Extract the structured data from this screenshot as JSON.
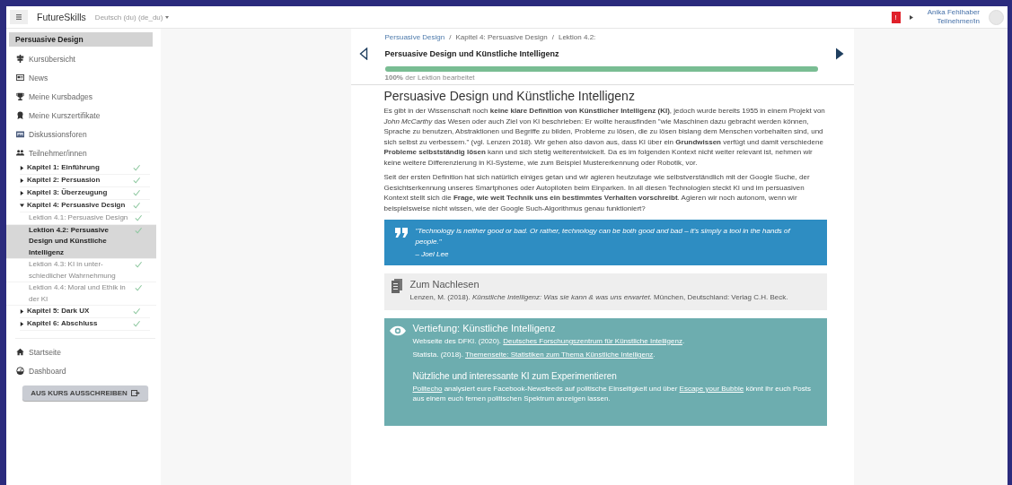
{
  "header": {
    "brand": "FutureSkills",
    "language": "Deutsch (du) (de_du)",
    "notification": "!",
    "user_name": "Anika Fehlhaber",
    "user_role": "Teilnehmer/in"
  },
  "sidebar": {
    "course_title": "Persuasive Design",
    "nav": [
      {
        "label": "Kursübersicht"
      },
      {
        "label": "News"
      },
      {
        "label": "Meine Kursbadges"
      },
      {
        "label": "Meine Kurszertifikate"
      },
      {
        "label": "Diskussionsforen"
      },
      {
        "label": "Teilnehmer/innen"
      }
    ],
    "chapters": [
      {
        "label": "Kapitel 1: Einführung",
        "expanded": false,
        "completed": true
      },
      {
        "label": "Kapitel 2: Persuasion",
        "expanded": false,
        "completed": true
      },
      {
        "label": "Kapitel 3: Überzeugung",
        "expanded": false,
        "completed": true
      },
      {
        "label": "Kapitel 4: Persuasive Design",
        "expanded": true,
        "completed": true,
        "children": [
          {
            "label": "Lektion 4.1: Persuasive Design",
            "selected": false,
            "completed": true
          },
          {
            "label": "Lektion 4.2: Persuasive Design und Künstliche Intelligenz",
            "selected": true,
            "completed": true
          },
          {
            "label": "Lektion 4.3: KI in unter-schiedlicher Wahrnehmung",
            "selected": false,
            "completed": true
          },
          {
            "label": "Lektion 4.4: Moral und Ethik in der KI",
            "selected": false,
            "completed": true
          }
        ]
      },
      {
        "label": "Kapitel 5: Dark UX",
        "expanded": false,
        "completed": true
      },
      {
        "label": "Kapitel 6: Abschluss",
        "expanded": false,
        "completed": true
      }
    ],
    "bottom_nav": [
      {
        "label": "Startseite"
      },
      {
        "label": "Dashboard"
      }
    ],
    "unenroll_button": "AUS KURS AUSSCHREIBEN"
  },
  "lesson": {
    "breadcrumb": [
      {
        "kind": "link",
        "text": "Persuasive Design"
      },
      {
        "kind": "separator",
        "text": "/"
      },
      {
        "kind": "text",
        "text": "Kapitel 4: Persuasive Design"
      },
      {
        "kind": "separator",
        "text": "/"
      },
      {
        "kind": "text",
        "text": "Lektion 4.2:"
      }
    ],
    "title": "Persuasive Design und Künstliche Intelligenz",
    "progress": {
      "level": 1,
      "label": "**100%** der Lektion bearbeitet"
    },
    "heading": "Persuasive Design und Künstliche Intelligenz",
    "paragraphs": [
      "Es gibt in der Wissenschaft noch **keine klare Definition von Künstlicher Intelligenz (KI)**, jedoch wurde bereits 1955 in einem Projekt von *John McCarthy* das Wesen oder auch Ziel von KI beschrieben: Er wollte herausfinden \"wie Maschinen dazu gebracht werden können, Sprache zu benutzen, Abstraktionen und Begriffe zu bilden, Probleme zu lösen, die zu lösen bislang dem Menschen vorbehalten sind, und sich selbst zu verbessern.\" (vgl. Lenzen 2018). Wir gehen also davon aus, dass KI über ein **Grundwissen** verfügt und damit verschiedene **Probleme selbstständig lösen** kann und sich stetig weiterentwickelt. Da es im folgenden Kontext nicht weiter relevant ist, nehmen wir keine weitere Differenzierung in KI-Systeme, wie zum Beispiel Mustererkennung oder Robotik, vor.",
      "Seit der ersten Definition hat sich natürlich einiges getan und wir agieren heutzutage wie selbstverständlich mit der Google Suche, der Gesichtserkennung unseres Smartphones oder Autopiloten beim Einparken. In all diesen Technologien steckt KI und im persuasiven Kontext stellt sich die **Frage, wie weit Technik uns ein bestimmtes Verhalten vorschreibt**. Agieren wir noch autonom, wenn wir beispielsweise nicht wissen, wie der Google Such-Algorithmus genau funktioniert?"
    ],
    "quote": {
      "text": "\"Technology is neither good or bad. Or rather, technology can be both good and bad – it's simply a tool in the hands of people.\"",
      "author": "– Joel Lee"
    },
    "reading": {
      "title": "Zum Nachlesen",
      "text": "Lenzen, M. (2018). *Künstliche Intelligenz: Was sie kann & was uns erwartet*. München, Deutschland: Verlag C.H. Beck."
    },
    "deepening": {
      "title": "Vertiefung: Künstliche Intelligenz",
      "sources": [
        [
          {
            "kind": "text",
            "text": "Webseite des DFKI. (2020). "
          },
          {
            "kind": "link",
            "text": "Deutsches Forschungszentrum für Künstliche Intelligenz"
          },
          {
            "kind": "text",
            "text": "."
          }
        ],
        [
          {
            "kind": "text",
            "text": "Statista. (2018). "
          },
          {
            "kind": "link",
            "text": "Themenseite: Statistiken zum Thema Künstliche Intelligenz"
          },
          {
            "kind": "text",
            "text": "."
          }
        ]
      ],
      "subheading": "Nützliche und interessante KI zum Experimentieren",
      "paragraph": [
        {
          "kind": "link",
          "text": "Politecho"
        },
        {
          "kind": "text",
          "text": " analysiert eure Facebook-Newsfeeds auf politische Einseitigkeit und über "
        },
        {
          "kind": "link",
          "text": "Escape your Bubble"
        },
        {
          "kind": "text",
          "text": " könnt ihr euch Posts aus einem euch fernen politischen Spektrum anzeigen lassen."
        }
      ]
    }
  }
}
